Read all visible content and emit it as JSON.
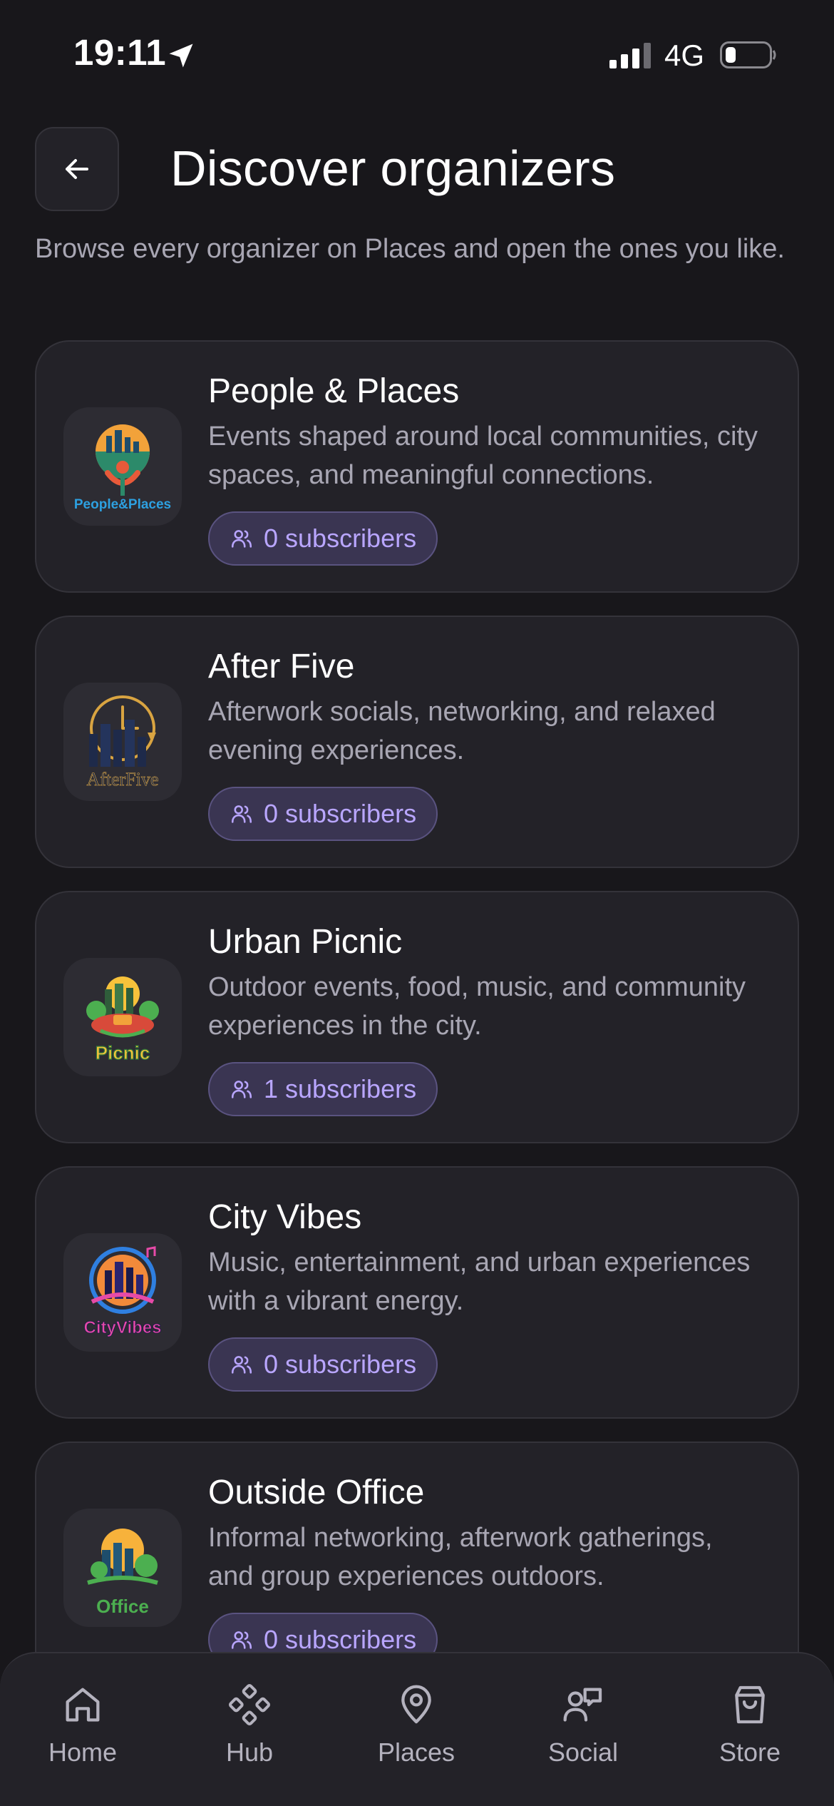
{
  "status_bar": {
    "time": "19:11",
    "network": "4G"
  },
  "header": {
    "title": "Discover organizers",
    "subtitle": "Browse every organizer on Places and open the ones you like."
  },
  "colors": {
    "background": "#18171b",
    "card": "#232228",
    "accent": "#b9a6ff",
    "badge_bg": "#3a3552"
  },
  "organizers": [
    {
      "name": "People & Places",
      "description": "Events shaped around local communities, city spaces, and meaningful connections.",
      "subscribers": "0 subscribers",
      "logo": "people-places-logo",
      "logo_text": "People&Places"
    },
    {
      "name": "After Five",
      "description": "Afterwork socials, networking, and relaxed evening experiences.",
      "subscribers": "0 subscribers",
      "logo": "after-five-logo",
      "logo_text": "AfterFive"
    },
    {
      "name": "Urban Picnic",
      "description": "Outdoor events, food, music, and community experiences in the city.",
      "subscribers": "1 subscribers",
      "logo": "urban-picnic-logo",
      "logo_text": "Picnic"
    },
    {
      "name": "City Vibes",
      "description": "Music, entertainment, and urban experiences with a vibrant energy.",
      "subscribers": "0 subscribers",
      "logo": "city-vibes-logo",
      "logo_text": "CityVibes"
    },
    {
      "name": "Outside Office",
      "description": "Informal networking, afterwork gatherings, and group experiences outdoors.",
      "subscribers": "0 subscribers",
      "logo": "outside-office-logo",
      "logo_text": "Office"
    }
  ],
  "tab_bar": {
    "tabs": [
      {
        "label": "Home",
        "icon": "home-icon"
      },
      {
        "label": "Hub",
        "icon": "hub-icon"
      },
      {
        "label": "Places",
        "icon": "map-pin-icon"
      },
      {
        "label": "Social",
        "icon": "social-icon"
      },
      {
        "label": "Store",
        "icon": "shopping-bag-icon"
      }
    ]
  }
}
